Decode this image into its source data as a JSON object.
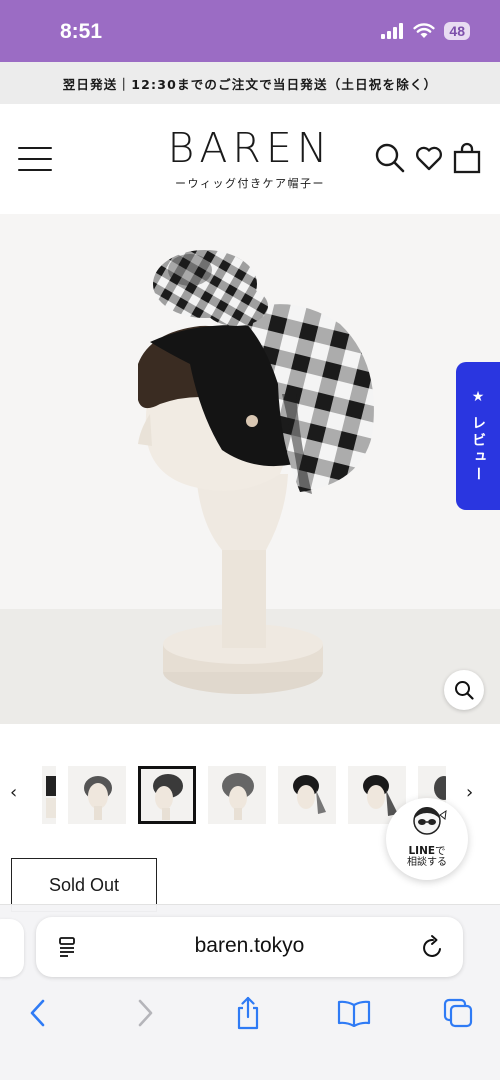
{
  "status_bar": {
    "time": "8:51",
    "battery": "48",
    "icons": [
      "signal-icon",
      "wifi-icon",
      "battery-icon"
    ]
  },
  "announcement": {
    "text": "翌日発送｜12:30までのご注文で当日発送（土日祝を除く）"
  },
  "header": {
    "logo": "BAREN",
    "tagline": "ーウィッグ付きケア帽子ー",
    "icons": [
      "menu-icon",
      "search-icon",
      "heart-icon",
      "bag-icon"
    ]
  },
  "review_tab": {
    "label": "★ レビュー",
    "color": "#2a36e0"
  },
  "gallery": {
    "thumbnail_count": 7,
    "active_index": 2
  },
  "line_button": {
    "brand": "LINE",
    "brand_suffix": "で",
    "label": "相談する"
  },
  "product": {
    "status": "Sold Out"
  },
  "browser": {
    "url": "baren.tokyo"
  },
  "colors": {
    "status_bar": "#9b6cc4",
    "announcement_bg": "#ececec",
    "accent": "#2a36e0",
    "browser_icons": "#2f7bf5"
  }
}
